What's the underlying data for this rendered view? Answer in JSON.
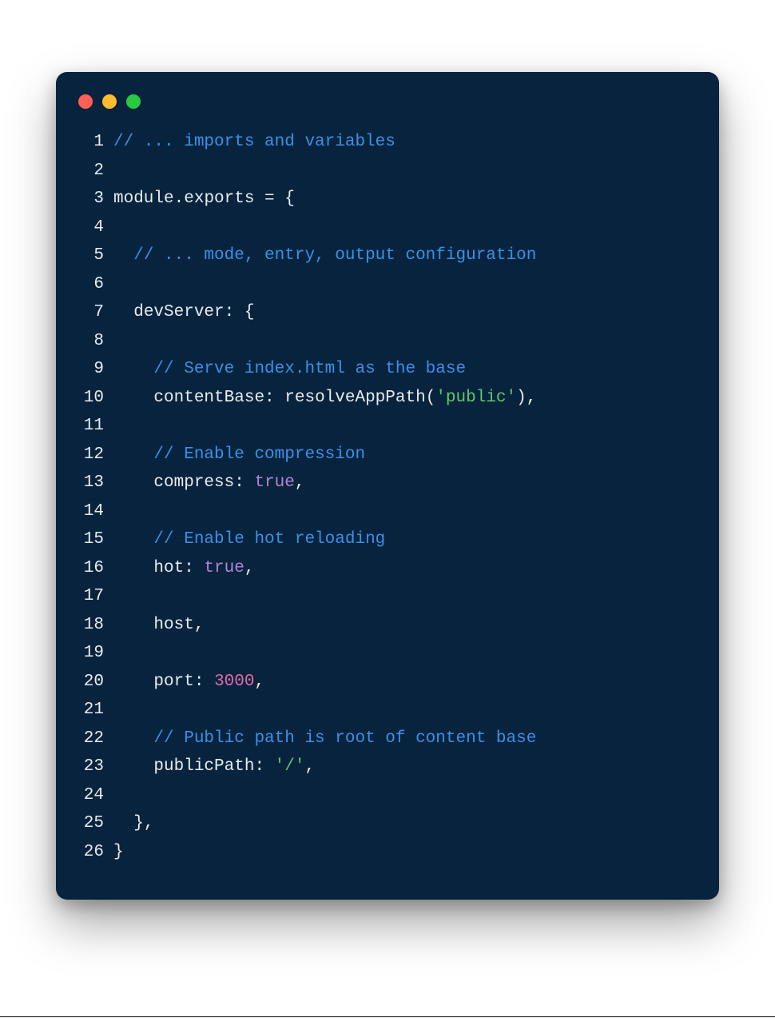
{
  "traffic_lights": [
    "close",
    "minimize",
    "zoom"
  ],
  "code": {
    "lines": [
      {
        "num": "1",
        "tokens": [
          {
            "cls": "tok-comment",
            "t": "// ... imports and variables"
          }
        ]
      },
      {
        "num": "2",
        "tokens": [
          {
            "cls": "tok-plain",
            "t": ""
          }
        ]
      },
      {
        "num": "3",
        "tokens": [
          {
            "cls": "tok-key",
            "t": "module"
          },
          {
            "cls": "tok-punc",
            "t": "."
          },
          {
            "cls": "tok-key",
            "t": "exports"
          },
          {
            "cls": "tok-punc",
            "t": " = {"
          }
        ]
      },
      {
        "num": "4",
        "tokens": [
          {
            "cls": "tok-plain",
            "t": ""
          }
        ]
      },
      {
        "num": "5",
        "tokens": [
          {
            "cls": "tok-plain",
            "t": "  "
          },
          {
            "cls": "tok-comment",
            "t": "// ... mode, entry, output configuration"
          }
        ]
      },
      {
        "num": "6",
        "tokens": [
          {
            "cls": "tok-plain",
            "t": ""
          }
        ]
      },
      {
        "num": "7",
        "tokens": [
          {
            "cls": "tok-plain",
            "t": "  "
          },
          {
            "cls": "tok-key",
            "t": "devServer"
          },
          {
            "cls": "tok-punc",
            "t": ":"
          },
          {
            "cls": "tok-plain",
            "t": " "
          },
          {
            "cls": "tok-punc",
            "t": "{"
          }
        ]
      },
      {
        "num": "8",
        "tokens": [
          {
            "cls": "tok-plain",
            "t": ""
          }
        ]
      },
      {
        "num": "9",
        "tokens": [
          {
            "cls": "tok-plain",
            "t": "    "
          },
          {
            "cls": "tok-comment",
            "t": "// Serve index.html as the base"
          }
        ]
      },
      {
        "num": "10",
        "tokens": [
          {
            "cls": "tok-plain",
            "t": "    "
          },
          {
            "cls": "tok-key",
            "t": "contentBase"
          },
          {
            "cls": "tok-punc",
            "t": ":"
          },
          {
            "cls": "tok-plain",
            "t": " "
          },
          {
            "cls": "tok-func",
            "t": "resolveAppPath"
          },
          {
            "cls": "tok-punc",
            "t": "("
          },
          {
            "cls": "tok-str",
            "t": "'public'"
          },
          {
            "cls": "tok-punc",
            "t": "),"
          }
        ]
      },
      {
        "num": "11",
        "tokens": [
          {
            "cls": "tok-plain",
            "t": ""
          }
        ]
      },
      {
        "num": "12",
        "tokens": [
          {
            "cls": "tok-plain",
            "t": "    "
          },
          {
            "cls": "tok-comment",
            "t": "// Enable compression"
          }
        ]
      },
      {
        "num": "13",
        "tokens": [
          {
            "cls": "tok-plain",
            "t": "    "
          },
          {
            "cls": "tok-key",
            "t": "compress"
          },
          {
            "cls": "tok-punc",
            "t": ":"
          },
          {
            "cls": "tok-plain",
            "t": " "
          },
          {
            "cls": "tok-bool",
            "t": "true"
          },
          {
            "cls": "tok-punc",
            "t": ","
          }
        ]
      },
      {
        "num": "14",
        "tokens": [
          {
            "cls": "tok-plain",
            "t": ""
          }
        ]
      },
      {
        "num": "15",
        "tokens": [
          {
            "cls": "tok-plain",
            "t": "    "
          },
          {
            "cls": "tok-comment",
            "t": "// Enable hot reloading"
          }
        ]
      },
      {
        "num": "16",
        "tokens": [
          {
            "cls": "tok-plain",
            "t": "    "
          },
          {
            "cls": "tok-key",
            "t": "hot"
          },
          {
            "cls": "tok-punc",
            "t": ":"
          },
          {
            "cls": "tok-plain",
            "t": " "
          },
          {
            "cls": "tok-bool",
            "t": "true"
          },
          {
            "cls": "tok-punc",
            "t": ","
          }
        ]
      },
      {
        "num": "17",
        "tokens": [
          {
            "cls": "tok-plain",
            "t": ""
          }
        ]
      },
      {
        "num": "18",
        "tokens": [
          {
            "cls": "tok-plain",
            "t": "    "
          },
          {
            "cls": "tok-key",
            "t": "host"
          },
          {
            "cls": "tok-punc",
            "t": ","
          }
        ]
      },
      {
        "num": "19",
        "tokens": [
          {
            "cls": "tok-plain",
            "t": ""
          }
        ]
      },
      {
        "num": "20",
        "tokens": [
          {
            "cls": "tok-plain",
            "t": "    "
          },
          {
            "cls": "tok-key",
            "t": "port"
          },
          {
            "cls": "tok-punc",
            "t": ":"
          },
          {
            "cls": "tok-plain",
            "t": " "
          },
          {
            "cls": "tok-num",
            "t": "3000"
          },
          {
            "cls": "tok-punc",
            "t": ","
          }
        ]
      },
      {
        "num": "21",
        "tokens": [
          {
            "cls": "tok-plain",
            "t": ""
          }
        ]
      },
      {
        "num": "22",
        "tokens": [
          {
            "cls": "tok-plain",
            "t": "    "
          },
          {
            "cls": "tok-comment",
            "t": "// Public path is root of content base"
          }
        ]
      },
      {
        "num": "23",
        "tokens": [
          {
            "cls": "tok-plain",
            "t": "    "
          },
          {
            "cls": "tok-key",
            "t": "publicPath"
          },
          {
            "cls": "tok-punc",
            "t": ":"
          },
          {
            "cls": "tok-plain",
            "t": " "
          },
          {
            "cls": "tok-str",
            "t": "'/'"
          },
          {
            "cls": "tok-punc",
            "t": ","
          }
        ]
      },
      {
        "num": "24",
        "tokens": [
          {
            "cls": "tok-plain",
            "t": ""
          }
        ]
      },
      {
        "num": "25",
        "tokens": [
          {
            "cls": "tok-plain",
            "t": "  "
          },
          {
            "cls": "tok-punc",
            "t": "},"
          }
        ]
      },
      {
        "num": "26",
        "tokens": [
          {
            "cls": "tok-punc",
            "t": "}"
          }
        ]
      }
    ]
  }
}
